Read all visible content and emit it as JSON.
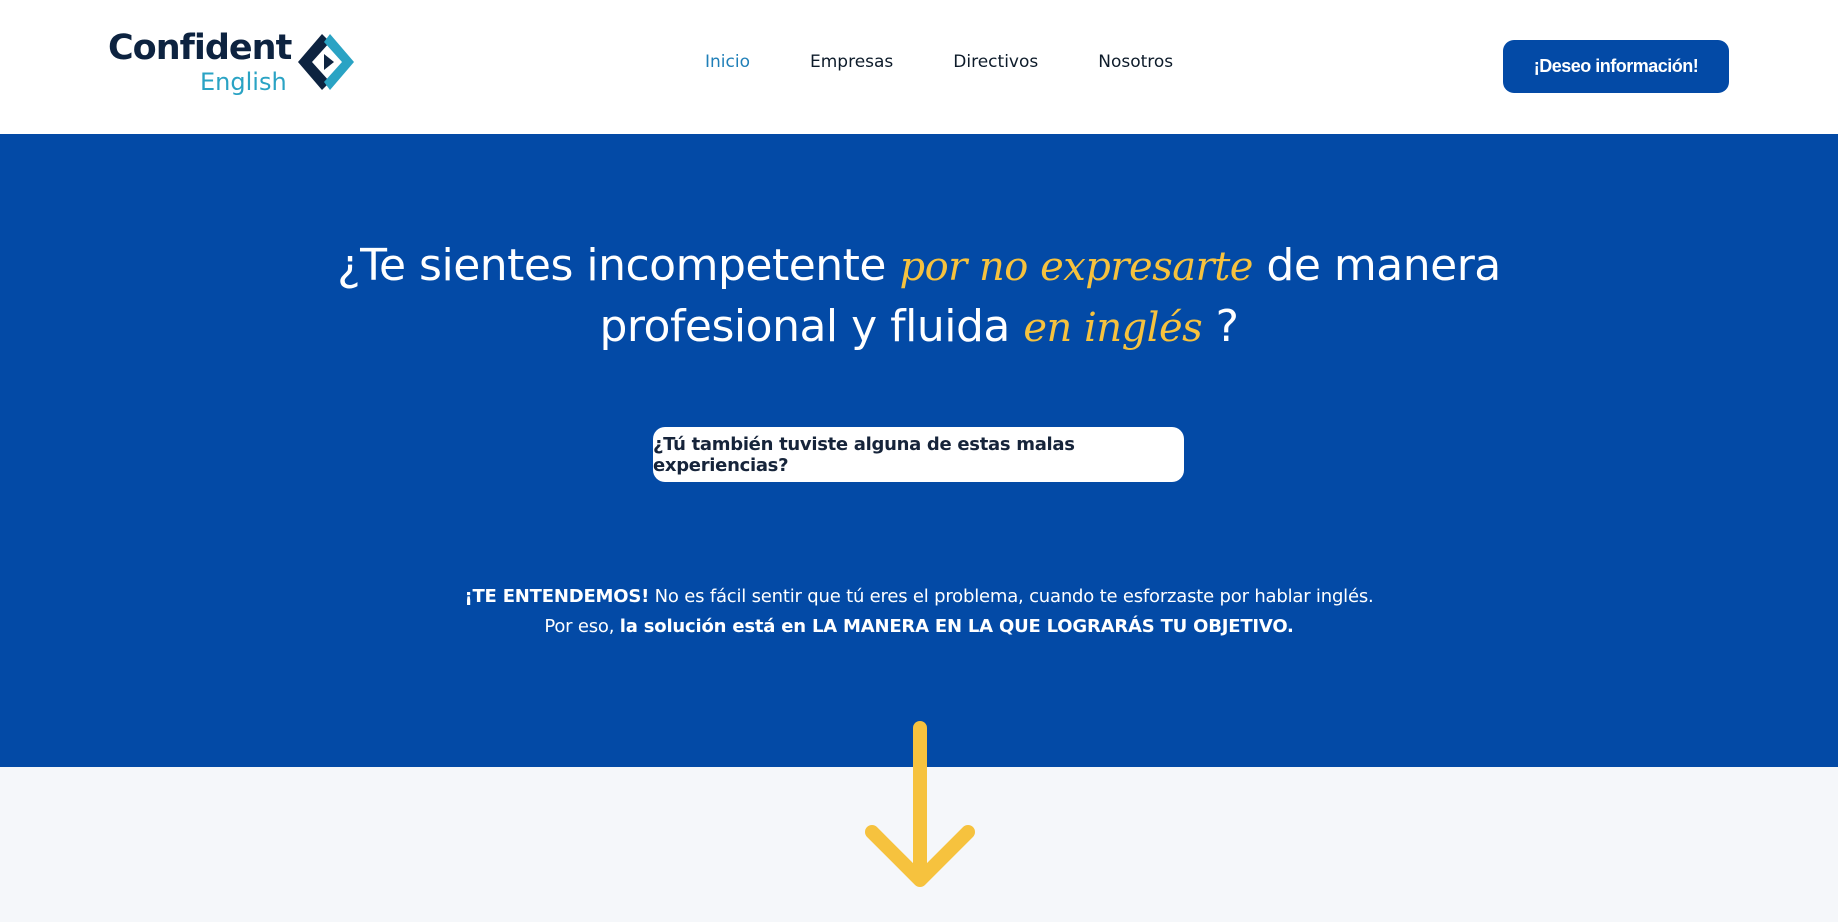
{
  "header": {
    "logo": {
      "main_text": "Confident",
      "sub_text": "English",
      "mark_colors": [
        "#0d2340",
        "#2aa3c4"
      ]
    },
    "nav": [
      {
        "label": "Inicio",
        "active": true
      },
      {
        "label": "Empresas",
        "active": false
      },
      {
        "label": "Directivos",
        "active": false
      },
      {
        "label": "Nosotros",
        "active": false
      }
    ],
    "cta_label": "¡Deseo información!"
  },
  "hero": {
    "title_part1": "¿Te sientes incompetente ",
    "title_accent1": "por no expresarte",
    "title_part2": " de manera",
    "title_part3": "profesional y fluida ",
    "title_accent2": "en inglés",
    "title_part4": " ?",
    "experience_button_label": "¿Tú también tuviste alguna de estas malas experiencias?",
    "line1_bold": "¡TE ENTENDEMOS!",
    "line1_rest": " No es fácil sentir que tú eres el problema, cuando te esforzaste por hablar inglés.",
    "line2_prefix": "Por eso, ",
    "line2_bold": "la solución está en LA MANERA EN LA QUE LOGRARÁS TU OBJETIVO."
  },
  "colors": {
    "primary_blue": "#034aa6",
    "accent_yellow": "#f6c23e",
    "nav_active": "#1f7fb8",
    "arrow": "#f6c23e"
  },
  "icons": {
    "logo_mark": "chevron-brackets-icon",
    "scroll_arrow": "arrow-down-icon"
  }
}
